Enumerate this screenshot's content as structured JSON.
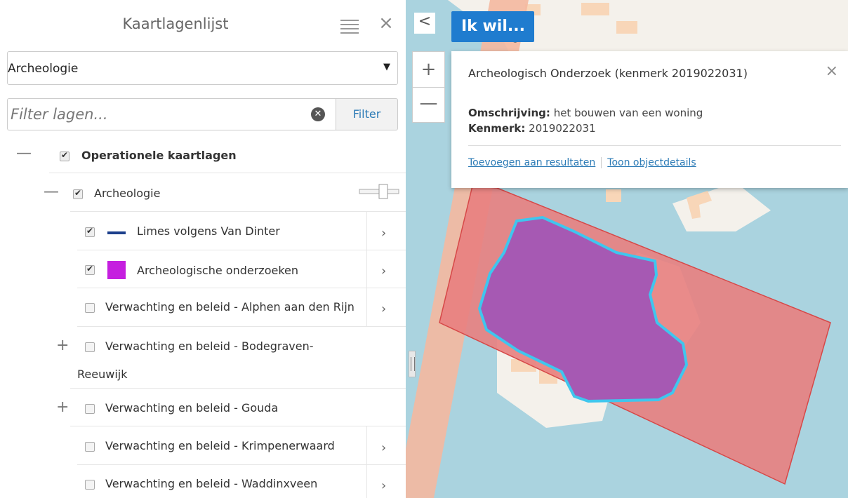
{
  "sidebar": {
    "title": "Kaartlagenlijst",
    "close_label": "×",
    "selected_layer_group": "Archeologie",
    "filter_placeholder": "Filter lagen...",
    "filter_button": "Filter",
    "tree": [
      {
        "label": "Operationele kaartlagen",
        "checked": true,
        "toggle": "—"
      },
      {
        "label": "Archeologie",
        "checked": true,
        "toggle": "—"
      },
      {
        "label": "Limes volgens Van Dinter",
        "checked": true,
        "legend": "line",
        "legend_color": "#1c3f8c"
      },
      {
        "label": "Archeologische onderzoeken",
        "checked": true,
        "legend": "fill",
        "legend_color": "#c51fdf"
      },
      {
        "label": "Verwachting en beleid - Alphen aan den Rijn",
        "checked": false
      },
      {
        "label_line1": "Verwachting en beleid - Bodegraven-",
        "label_line2": "Reeuwijk",
        "checked": false,
        "toggle": "+"
      },
      {
        "label": "Verwachting en beleid - Gouda",
        "checked": false,
        "toggle": "+"
      },
      {
        "label": "Verwachting en beleid - Krimpenerwaard",
        "checked": false
      },
      {
        "label": "Verwachting en beleid - Waddinxveen",
        "checked": false
      }
    ]
  },
  "map": {
    "ik_wil_label": "Ik wil...",
    "collapse_label": "<",
    "zoom_in": "+",
    "zoom_out": "—",
    "street_label": "dijk",
    "popup": {
      "title": "Archeologisch Onderzoek (kenmerk 2019022031)",
      "close": "×",
      "description_label": "Omschrijving:",
      "description_value": "het bouwen van een woning",
      "kenmerk_label": "Kenmerk:",
      "kenmerk_value": "2019022031",
      "link_add": "Toevoegen aan resultaten",
      "link_details": "Toon objectdetails"
    },
    "colors": {
      "water": "#aad3df",
      "land": "#f5f2ec",
      "building": "#f8d6b8",
      "parcel_fill": "#e88080",
      "survey_fill": "#a659b3",
      "survey_outline": "#3fc6ee",
      "road": "#f4b8a0"
    }
  }
}
